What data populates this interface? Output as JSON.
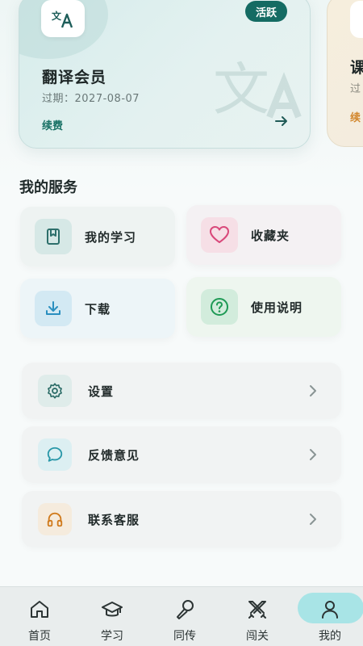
{
  "membership": {
    "primary": {
      "icon": "translate-icon",
      "badge": "活跃",
      "title": "翻译会员",
      "expiry": "过期：2027-08-07",
      "renew": "续费"
    },
    "secondary": {
      "title_partial": "课",
      "expiry_partial": "过",
      "renew_partial": "续"
    }
  },
  "services": {
    "title": "我的服务",
    "tiles": [
      {
        "label": "我的学习",
        "icon": "book-icon",
        "color": "#2d6f6b"
      },
      {
        "label": "收藏夹",
        "icon": "heart-icon",
        "color": "#d9487a"
      },
      {
        "label": "下载",
        "icon": "download-icon",
        "color": "#2a8fbf"
      },
      {
        "label": "使用说明",
        "icon": "help-circle-icon",
        "color": "#1e9a55"
      }
    ]
  },
  "settings_list": [
    {
      "label": "设置",
      "icon": "gear-icon",
      "color": "#2a6b66"
    },
    {
      "label": "反馈意见",
      "icon": "chat-bubble-icon",
      "color": "#2897a8"
    },
    {
      "label": "联系客服",
      "icon": "headphones-icon",
      "color": "#d07a1c"
    }
  ],
  "nav": {
    "items": [
      {
        "label": "首页",
        "icon": "home-icon"
      },
      {
        "label": "学习",
        "icon": "graduation-cap-icon"
      },
      {
        "label": "同传",
        "icon": "microphone-icon"
      },
      {
        "label": "闯关",
        "icon": "crossed-swords-icon"
      },
      {
        "label": "我的",
        "icon": "user-icon"
      }
    ],
    "active": "我的"
  }
}
